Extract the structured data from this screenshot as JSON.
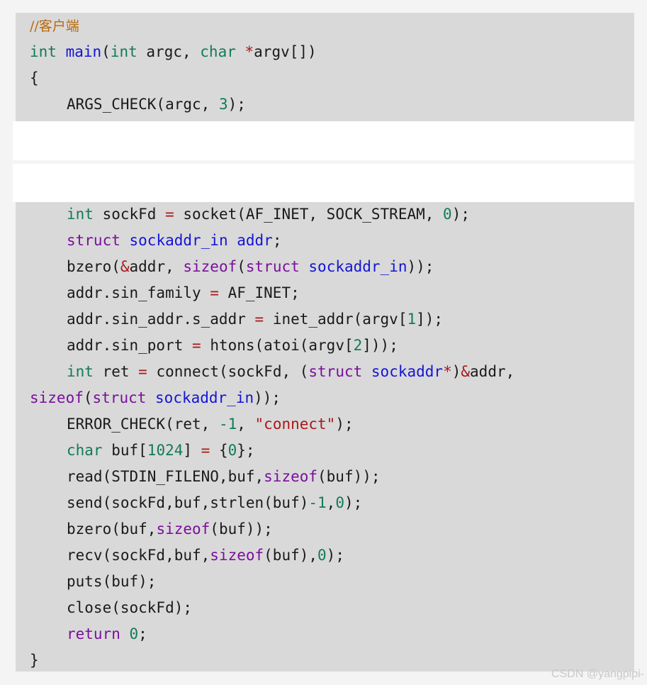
{
  "top_code": {
    "comment": "//客户端",
    "kw_int": "int",
    "fn_main": "main",
    "open_paren": "(",
    "kw_int2": "int",
    "argc_text": " argc, ",
    "kw_char": "char",
    "star": " *",
    "argv_text": "argv[])",
    "brace_open": "{",
    "args_check_pre": "ARGS_CHECK(argc, ",
    "args_check_num": "3",
    "args_check_post": ");"
  },
  "bottom_code": {
    "l1": {
      "kw": "int",
      "a": " sockFd ",
      "op": "=",
      "b": " socket(AF_INET, SOCK_STREAM, ",
      "num": "0",
      "c": ");"
    },
    "l2": {
      "kw": "struct",
      "a": " ",
      "ty": "sockaddr_in",
      "b": " ",
      "ty2": "addr",
      "c": ";"
    },
    "l3": {
      "a": "bzero(",
      "op": "&",
      "b": "addr, ",
      "kw": "sizeof",
      "c": "(",
      "kw2": "struct",
      "d": " ",
      "ty": "sockaddr_in",
      "e": "));"
    },
    "l4": {
      "a": "addr.sin_family ",
      "op": "=",
      "b": " AF_INET;"
    },
    "l5": {
      "a": "addr.sin_addr.s_addr ",
      "op": "=",
      "b": " inet_addr(argv[",
      "num": "1",
      "c": "]);"
    },
    "l6": {
      "a": "addr.sin_port ",
      "op": "=",
      "b": " htons(atoi(argv[",
      "num": "2",
      "c": "]));"
    },
    "l7": {
      "kw": "int",
      "a": " ret ",
      "op": "=",
      "b": " connect(sockFd, (",
      "kw2": "struct",
      "c": " ",
      "ty": "sockaddr",
      "op2": "*",
      "d": ")",
      "op3": "&",
      "e": "addr,"
    },
    "l8": {
      "kw": "sizeof",
      "a": "(",
      "kw2": "struct",
      "b": " ",
      "ty": "sockaddr_in",
      "c": "));"
    },
    "l9": {
      "a": "ERROR_CHECK(ret, ",
      "num": "-1",
      "b": ", ",
      "str": "\"connect\"",
      "c": ");"
    },
    "l10": {
      "kw": "char",
      "a": " buf[",
      "num": "1024",
      "b": "] ",
      "op": "=",
      "c": " {",
      "num2": "0",
      "d": "};"
    },
    "l11": {
      "a": "read(STDIN_FILENO,buf,",
      "kw": "sizeof",
      "b": "(buf));"
    },
    "l12": {
      "a": "send(sockFd,buf,strlen(buf)",
      "num": "-1",
      "b": ",",
      "num2": "0",
      "c": ");"
    },
    "l13": {
      "a": "bzero(buf,",
      "kw": "sizeof",
      "b": "(buf));"
    },
    "l14": {
      "a": "recv(sockFd,buf,",
      "kw": "sizeof",
      "b": "(buf),",
      "num": "0",
      "c": ");"
    },
    "l15": {
      "a": "puts(buf);"
    },
    "l16": {
      "a": "close(sockFd);"
    },
    "l17": {
      "kw": "return",
      "a": " ",
      "num": "0",
      "b": ";"
    },
    "l18": {
      "a": "}"
    }
  },
  "watermark": "CSDN @yangpipi-"
}
